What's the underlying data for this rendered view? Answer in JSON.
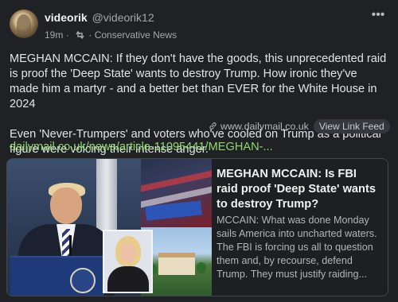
{
  "author": {
    "name": "videorik",
    "handle": "@videorik12"
  },
  "meta": {
    "time": "19m",
    "separator": "·",
    "boost_icon": "repost-icon",
    "separator2": "·",
    "source": "Conservative News"
  },
  "more_icon": "more-dots-icon",
  "more_glyph": "•••",
  "post": {
    "paragraph1": "MEGHAN MCCAIN: If they don't have the goods, this unprecedented raid is proof the 'Deep State' wants to destroy Trump. How ironic they've made him a martyr - and a better bet than EVER for the White House in 2024",
    "paragraph2": "Even 'Never-Trumpers' and voters who've cooled on Trump as a political figure were voicing their intense anger.",
    "link_text": "dailymail.co.uk/news/article-11095441/MEGHAN-..."
  },
  "card": {
    "title": "MEGHAN MCCAIN: Is FBI raid proof 'Deep State' wants to destroy Trump?",
    "description": "MCCAIN: What was done Monday sails America into uncharted waters. The FBI is forcing us all to question them and, by recourse, defend Trump. They must justify raiding...",
    "domain": "www.dailymail.co.uk",
    "view_button": "View Link Feed",
    "link_icon": "link-icon"
  },
  "colors": {
    "background": "#1f2125",
    "link": "#8dd76d",
    "muted": "#a4a7ad"
  }
}
